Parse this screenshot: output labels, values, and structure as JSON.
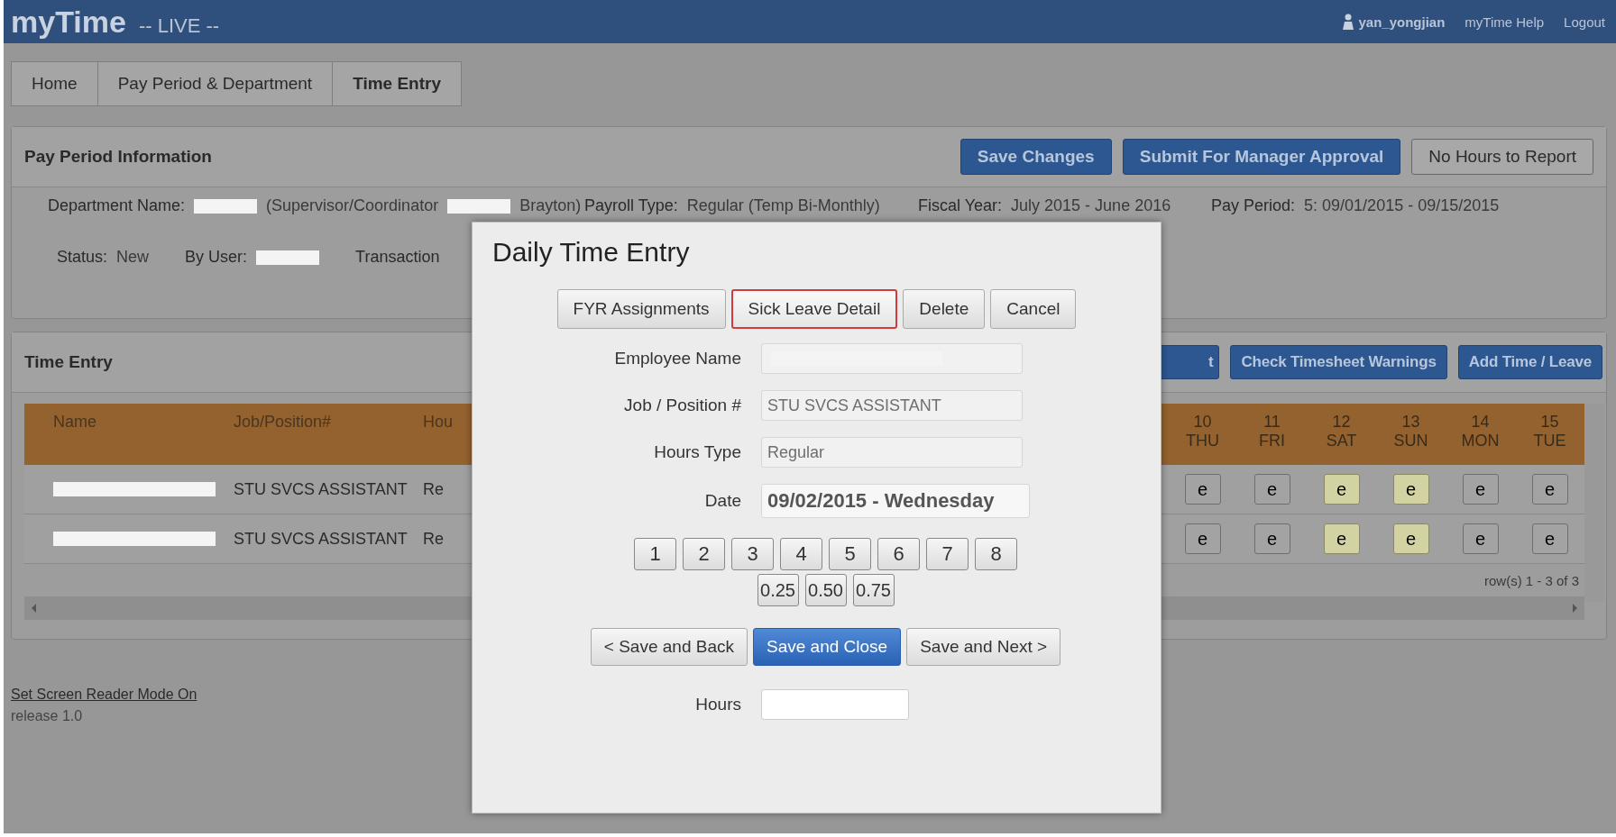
{
  "app": {
    "title": "myTime",
    "env": "-- LIVE --"
  },
  "user_menu": {
    "user": "yan_yongjian",
    "links": [
      "myTime Help",
      "Logout"
    ]
  },
  "breadcrumbs": [
    {
      "label": "Home",
      "selected": false
    },
    {
      "label": "Pay Period & Department",
      "selected": false
    },
    {
      "label": "Time Entry",
      "selected": true
    }
  ],
  "pay_period": {
    "title": "Pay Period Information",
    "buttons": [
      {
        "label": "Save Changes",
        "kind": "primary"
      },
      {
        "label": "Submit For Manager Approval",
        "kind": "primary"
      },
      {
        "label": "No Hours to Report",
        "kind": "default"
      }
    ],
    "first_line": [
      {
        "label": "Department Name:",
        "parts": [
          {
            "kind": "redacted"
          },
          {
            "kind": "text",
            "text": "(Supervisor/Coordinator"
          },
          {
            "kind": "redacted"
          },
          {
            "kind": "text",
            "text": "Brayton)"
          }
        ]
      },
      {
        "label": "Payroll Type:",
        "parts": [
          {
            "kind": "text",
            "text": "Regular (Temp Bi-Monthly)"
          }
        ]
      },
      {
        "label": "Fiscal Year:",
        "parts": [
          {
            "kind": "text",
            "text": "July 2015 - June 2016"
          }
        ]
      },
      {
        "label": "Pay Period:",
        "parts": [
          {
            "kind": "text",
            "text": "5: 09/01/2015 - 09/15/2015"
          }
        ]
      }
    ],
    "second_line": [
      {
        "label": "Status:",
        "parts": [
          {
            "kind": "text",
            "text": "New"
          }
        ]
      },
      {
        "label": "By User:",
        "parts": [
          {
            "kind": "redacted"
          }
        ]
      },
      {
        "label": "Transaction"
      }
    ]
  },
  "time_entry": {
    "title": "Time Entry",
    "buttons": [
      {
        "label": "t",
        "kind": "primary"
      },
      {
        "label": "Check Timesheet Warnings",
        "kind": "primary"
      },
      {
        "label": "Add Time / Leave",
        "kind": "primary"
      }
    ],
    "columns": [
      "Name",
      "Job/Position#",
      "Hou"
    ],
    "day_columns": [
      {
        "day": "10",
        "weekday": "THU"
      },
      {
        "day": "11",
        "weekday": "FRI"
      },
      {
        "day": "12",
        "weekday": "SAT"
      },
      {
        "day": "13",
        "weekday": "SUN"
      },
      {
        "day": "14",
        "weekday": "MON"
      },
      {
        "day": "15",
        "weekday": "TUE"
      }
    ],
    "rows": [
      {
        "name_redacted": true,
        "job": "STU SVCS ASSISTANT",
        "hours_type": "Re",
        "days": [
          {
            "label": "e",
            "weekend": false
          },
          {
            "label": "e",
            "weekend": false
          },
          {
            "label": "e",
            "weekend": true
          },
          {
            "label": "e",
            "weekend": true
          },
          {
            "label": "e",
            "weekend": false
          },
          {
            "label": "e",
            "weekend": false
          }
        ]
      },
      {
        "name_redacted": true,
        "job": "STU SVCS ASSISTANT",
        "hours_type": "Re",
        "days": [
          {
            "label": "e",
            "weekend": false
          },
          {
            "label": "e",
            "weekend": false
          },
          {
            "label": "e",
            "weekend": true
          },
          {
            "label": "e",
            "weekend": true
          },
          {
            "label": "e",
            "weekend": false
          },
          {
            "label": "e",
            "weekend": false
          }
        ]
      }
    ],
    "pager": "row(s) 1 - 3 of 3"
  },
  "footer": {
    "link": "Set Screen Reader Mode On",
    "release": "release 1.0"
  },
  "dialog": {
    "title": "Daily Time Entry",
    "actions": [
      {
        "label": "FYR Assignments",
        "focused": false
      },
      {
        "label": "Sick Leave Detail",
        "focused": true
      },
      {
        "label": "Delete",
        "focused": false
      },
      {
        "label": "Cancel",
        "focused": false
      }
    ],
    "fields": [
      {
        "label": "Employee Name",
        "kind": "redacted"
      },
      {
        "label": "Job / Position #",
        "kind": "readonly",
        "value": "STU SVCS ASSISTANT"
      },
      {
        "label": "Hours Type",
        "kind": "readonly",
        "value": "Regular"
      },
      {
        "label": "Date",
        "kind": "date",
        "value": "09/02/2015 - Wednesday"
      }
    ],
    "hour_buttons": [
      "1",
      "2",
      "3",
      "4",
      "5",
      "6",
      "7",
      "8"
    ],
    "fraction_buttons": [
      "0.25",
      "0.50",
      "0.75"
    ],
    "nav_buttons": [
      {
        "label": "< Save and Back",
        "kind": "default"
      },
      {
        "label": "Save and Close",
        "kind": "primary"
      },
      {
        "label": "Save and Next >",
        "kind": "default"
      }
    ],
    "hours_field": {
      "label": "Hours"
    }
  }
}
